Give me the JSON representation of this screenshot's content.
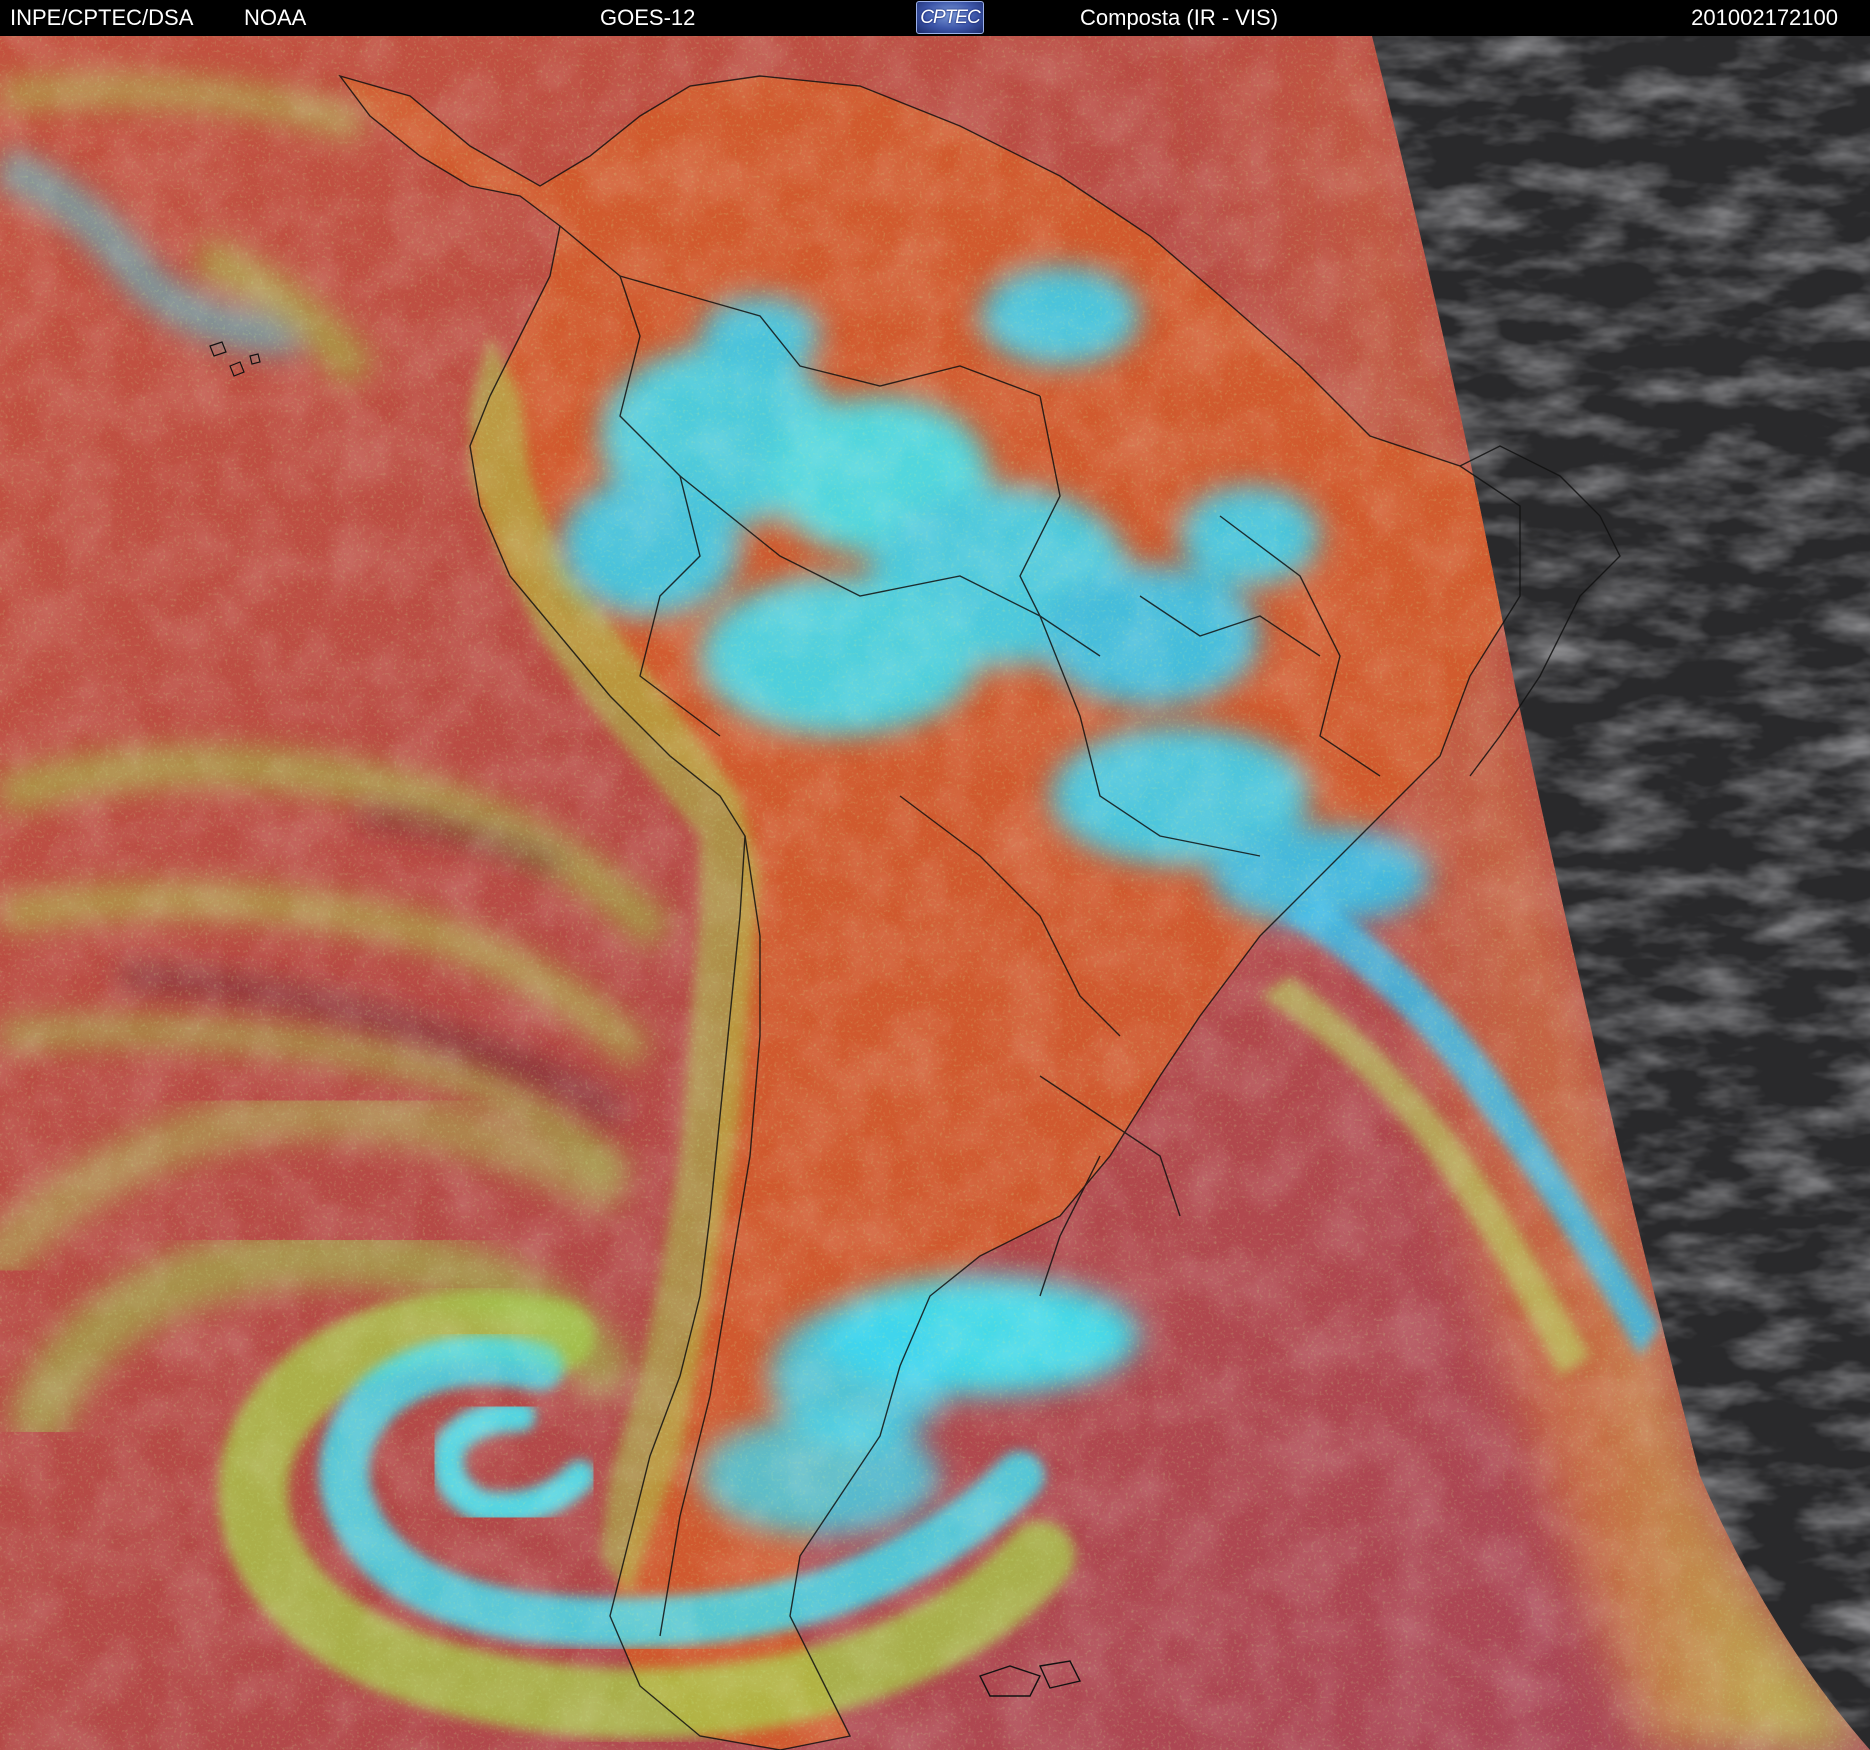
{
  "header": {
    "agency": "INPE/CPTEC/DSA",
    "source": "NOAA",
    "satellite": "GOES-12",
    "logo_text": "CPTEC",
    "product": "Composta (IR - VIS)",
    "timestamp": "201002172100"
  },
  "colors": {
    "header_bg": "#000000",
    "header_text": "#ffffff",
    "clear_ocean": "#b84c45",
    "land_warm": "#d55a2c",
    "low_cloud": "#9fd84e",
    "high_cloud": "#39e0ee",
    "night_side": "#2a2a2c",
    "coastline": "#111111"
  }
}
